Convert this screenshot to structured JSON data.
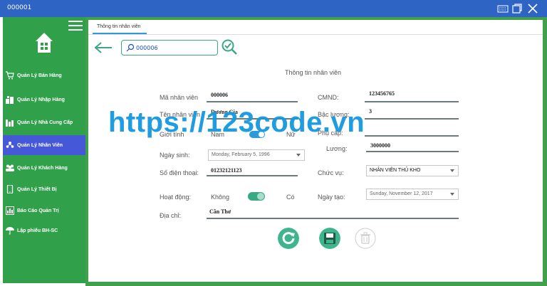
{
  "window": {
    "title": "000001"
  },
  "sidebar": {
    "items": [
      {
        "label": "Quản Lý Bán Hàng",
        "icon": "cart-icon"
      },
      {
        "label": "Quản Lý Nhập Hàng",
        "icon": "import-icon"
      },
      {
        "label": "Quản Lý Nhà Cung Cấp",
        "icon": "supplier-icon"
      },
      {
        "label": "Quản Lý Nhân Viên",
        "icon": "staff-icon",
        "active": true
      },
      {
        "label": "Quản Lý Khách Hàng",
        "icon": "customers-icon"
      },
      {
        "label": "Quản Lý Thiết Bị",
        "icon": "device-icon"
      },
      {
        "label": "Báo Cáo Quản Trị",
        "icon": "report-icon"
      },
      {
        "label": "Lập phiếu BH-SC",
        "icon": "umbrella-icon"
      }
    ]
  },
  "tab": {
    "label": "Thông tin nhân viên"
  },
  "search": {
    "value": "000006"
  },
  "form": {
    "title": "Thông tin nhân viên",
    "ma_nhan_vien": {
      "label": "Mã nhân viên",
      "value": "000006"
    },
    "ten_nhan_vien": {
      "label": "Tên nhân viên",
      "value": "Dương Gia"
    },
    "gioi_tinh": {
      "label": "Giới tính",
      "off_label": "Nam",
      "on_label": "Nữ"
    },
    "ngay_sinh": {
      "label": "Ngày sinh:",
      "value": "Monday, February 5, 1996"
    },
    "so_dien_thoai": {
      "label": "Số điện thoại:",
      "value": "01232121123"
    },
    "hoat_dong": {
      "label": "Hoạt động:",
      "off_label": "Không",
      "on_label": "Có"
    },
    "dia_chi": {
      "label": "Địa chỉ:",
      "value": "Cần Thơ"
    },
    "cmnd": {
      "label": "CMND:",
      "value": "123456765"
    },
    "bac_luong": {
      "label": "Bậc lương:",
      "value": "3"
    },
    "phu_cap": {
      "label": "Phụ cấp:"
    },
    "luong": {
      "label": "Lương:",
      "value": "3000000"
    },
    "chuc_vu": {
      "label": "Chức vụ:",
      "value": "NHÂN VIÊN THỦ KHO"
    },
    "ngay_tao": {
      "label": "Ngày tạo:",
      "value": "Sunday, November 12, 2017"
    }
  },
  "watermark": {
    "text": "https://123code.vn"
  },
  "colors": {
    "titlebar": "#2e64c4",
    "sidebar": "#30a14a",
    "active": "#4458d8",
    "accent": "#3aa882",
    "watermark": "#1798e0"
  }
}
